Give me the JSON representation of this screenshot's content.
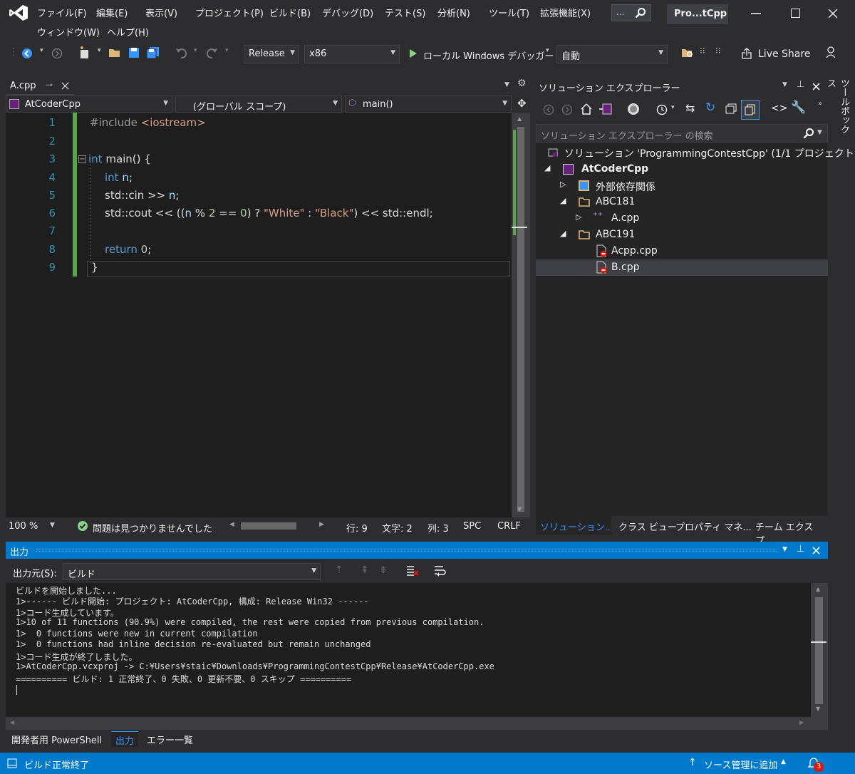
{
  "menu": [
    "ファイル(F)",
    "編集(E)",
    "表示(V)",
    "プロジェクト(P)",
    "ビルド(B)",
    "デバッグ(D)",
    "テスト(S)",
    "分析(N)",
    "ツール(T)",
    "拡張機能(X)",
    "ウィンドウ(W)",
    "ヘルプ(H)"
  ],
  "search_label": "...",
  "window_title": "Pro...tCpp",
  "toolbar": {
    "config": "Release",
    "platform": "x86",
    "debugger": "ローカル Windows デバッガー",
    "auto": "自動",
    "live_share": "Live Share"
  },
  "editor": {
    "tab_name": "A.cpp",
    "project_combo": "AtCoderCpp",
    "scope_combo": "(グローバル スコープ)",
    "member_combo": "main()",
    "line_numbers": [
      "1",
      "2",
      "3",
      "4",
      "5",
      "6",
      "7",
      "8",
      "9"
    ],
    "code": {
      "l1_pp": "#include ",
      "l1_inc": "<iostream>",
      "l3_kw": "int",
      "l3_txt": " main() {",
      "l4_kw": "int",
      "l4_id": " n",
      "l4_txt": ";",
      "l5_txt": "std::cin >> ",
      "l5_id": "n",
      "l5_end": ";",
      "l6_a": "std::cout << ((",
      "l6_id": "n",
      "l6_b": " % ",
      "l6_n2": "2",
      "l6_c": " == ",
      "l6_n0": "0",
      "l6_d": ") ? ",
      "l6_s1": "\"White\"",
      "l6_e": " : ",
      "l6_s2": "\"Black\"",
      "l6_f": ") << std::endl;",
      "l8_kw": "return",
      "l8_sp": " ",
      "l8_num": "0",
      "l8_end": ";",
      "l9_txt": "}"
    },
    "status": {
      "zoom": "100 %",
      "issues": "問題は見つかりませんでした",
      "line": "行: 9",
      "char": "文字: 2",
      "col": "列: 3",
      "spc": "SPC",
      "crlf": "CRLF"
    }
  },
  "solution_explorer": {
    "title": "ソリューション エクスプローラー",
    "search_placeholder": "ソリューション エクスプローラー の検索",
    "items": [
      {
        "label": "ソリューション 'ProgrammingContestCpp' (1/1 プロジェクト)"
      },
      {
        "label": "AtCoderCpp"
      },
      {
        "label": "外部依存関係"
      },
      {
        "label": "ABC181"
      },
      {
        "label": "A.cpp"
      },
      {
        "label": "ABC191"
      },
      {
        "label": "Acpp.cpp"
      },
      {
        "label": "B.cpp"
      }
    ],
    "tabs": [
      "ソリューション...",
      "クラス ビュー",
      "プロパティ マネ...",
      "チーム エクスプ..."
    ]
  },
  "toolbox_label": "ツールボックス",
  "output": {
    "title": "出力",
    "source_label": "出力元(S):",
    "source_value": "ビルド",
    "lines": [
      "ビルドを開始しました...",
      "1>------ ビルド開始: プロジェクト: AtCoderCpp, 構成: Release Win32 ------",
      "1>コード生成しています。",
      "1>10 of 11 functions (90.9%) were compiled, the rest were copied from previous compilation.",
      "1>  0 functions were new in current compilation",
      "1>  0 functions had inline decision re-evaluated but remain unchanged",
      "1>コード生成が終了しました。",
      "1>AtCoderCpp.vcxproj -> C:¥Users¥staic¥Downloads¥ProgrammingContestCpp¥Release¥AtCoderCpp.exe",
      "========== ビルド: 1 正常終了、0 失敗、0 更新不要、0 スキップ =========="
    ]
  },
  "bottom_tabs": [
    "開発者用 PowerShell",
    "出力",
    "エラー一覧"
  ],
  "statusbar": {
    "left": "ビルド正常終了",
    "source_control": "ソース管理に追加",
    "notif_count": "3"
  }
}
